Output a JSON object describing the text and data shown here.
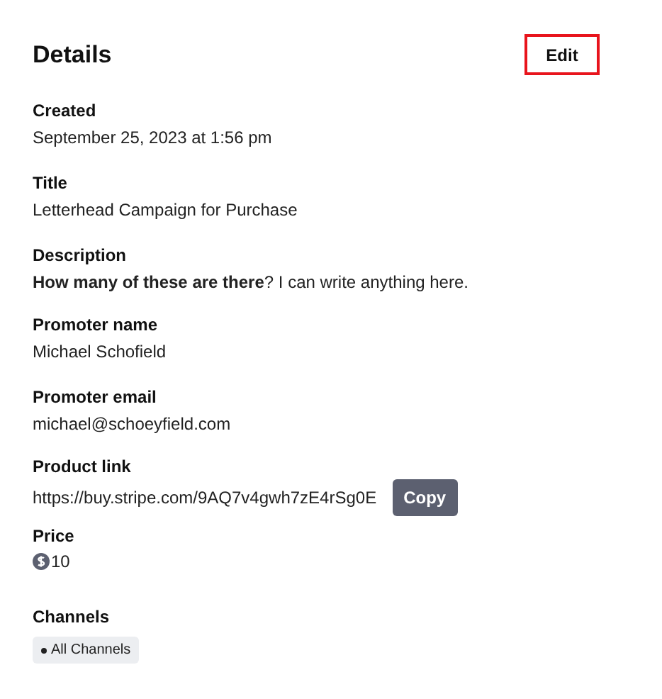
{
  "heading": "Details",
  "edit_button": "Edit",
  "fields": [
    {
      "kind": "text",
      "label": "Created",
      "value": "September 25, 2023 at 1:56 pm"
    },
    {
      "kind": "text",
      "label": "Title",
      "value": "Letterhead Campaign for Purchase"
    },
    {
      "kind": "text",
      "label": "Description",
      "value": "**How many of these are there**? I can write anything here."
    },
    {
      "kind": "text",
      "label": "Promoter name",
      "value": "Michael Schofield"
    },
    {
      "kind": "text",
      "label": "Promoter email",
      "value": "michael@schoeyfield.com"
    },
    {
      "kind": "link",
      "label": "Product link",
      "value": "https://buy.stripe.com/9AQ7v4gwh7zE4rSg0E",
      "button": "Copy"
    },
    {
      "kind": "price",
      "label": "Price",
      "value": "10"
    },
    {
      "kind": "tags",
      "label": "Channels",
      "tags": [
        "All Channels"
      ]
    }
  ]
}
